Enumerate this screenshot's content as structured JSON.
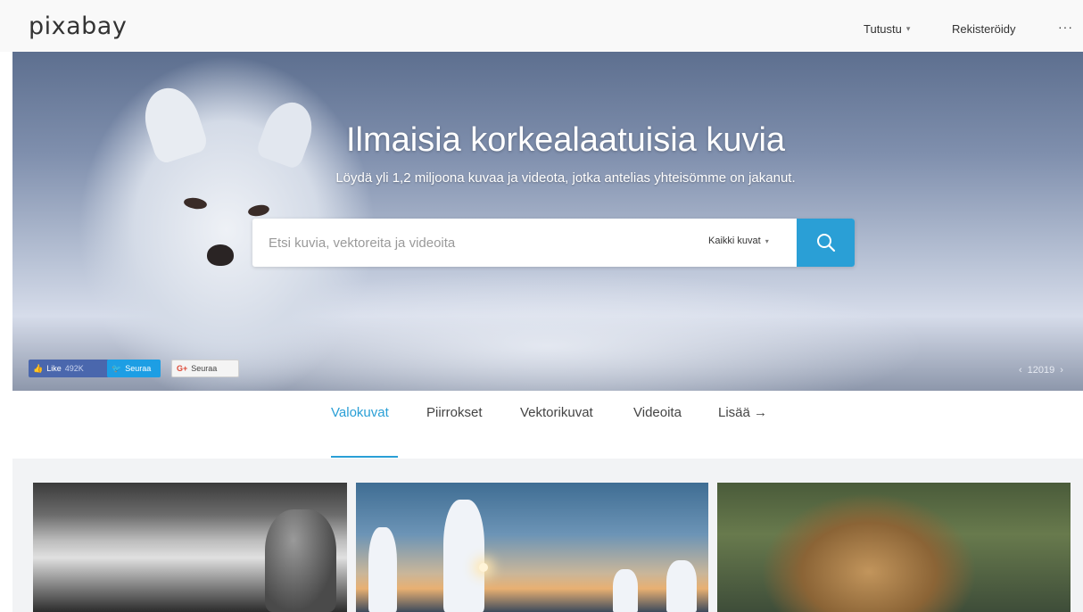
{
  "header": {
    "logo": "pixabay",
    "explore_label": "Tutustu",
    "register_label": "Rekisteröidy",
    "more_label": "···"
  },
  "hero": {
    "title": "Ilmaisia korkealaatuisia kuvia",
    "subtitle": "Löydä yli 1,2 miljoona kuvaa ja videota, jotka antelias yhteisömme on jakanut.",
    "search": {
      "placeholder": "Etsi kuvia, vektoreita ja videoita",
      "type_label": "Kaikki kuvat"
    },
    "social": {
      "facebook_label": "Like",
      "facebook_count": "492K",
      "twitter_label": "Seuraa",
      "googleplus_label": "Seuraa"
    },
    "pager_value": "12019"
  },
  "tabs": [
    {
      "label": "Valokuvat",
      "active": true
    },
    {
      "label": "Piirrokset",
      "active": false
    },
    {
      "label": "Vektorikuvat",
      "active": false
    },
    {
      "label": "Videoita",
      "active": false
    },
    {
      "label": "Lisää →",
      "active": false
    }
  ],
  "colors": {
    "accent": "#2a9fd6",
    "facebook": "#4a67ad",
    "twitter": "#1d9ee4"
  }
}
